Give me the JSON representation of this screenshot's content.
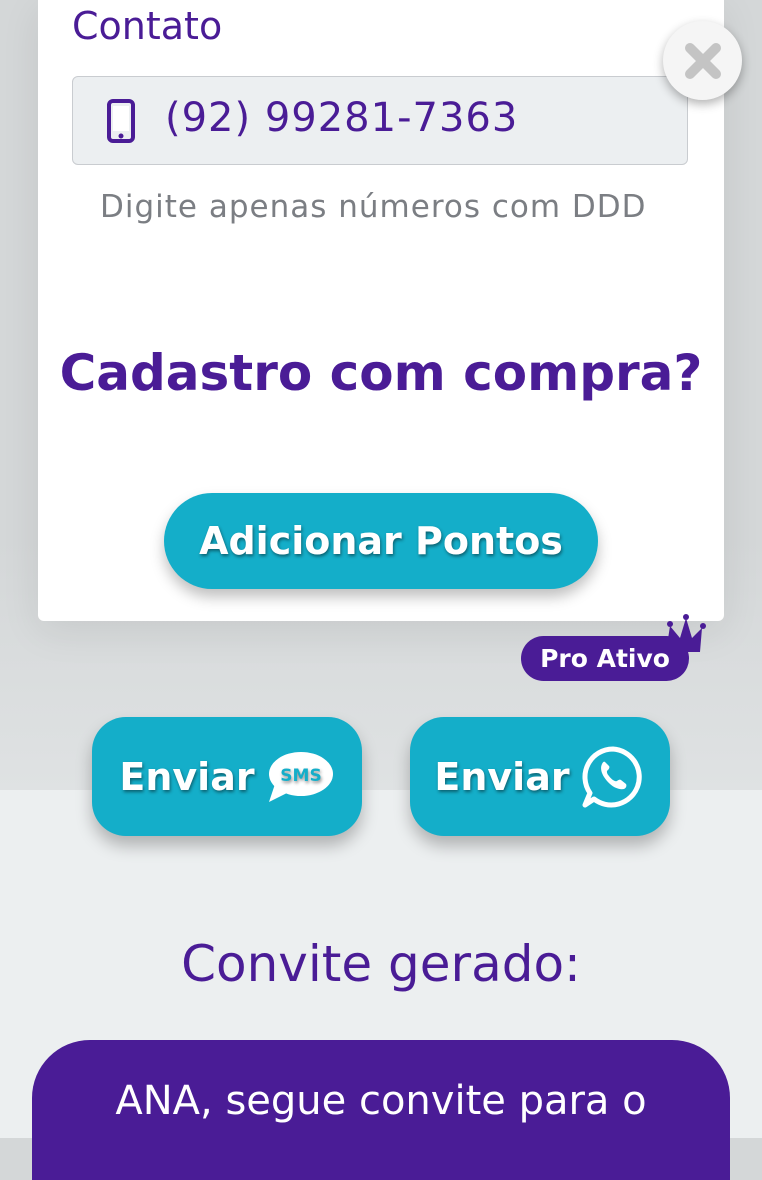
{
  "contact": {
    "label": "Contato",
    "phone_value": "(92) 99281-7363",
    "hint": "Digite apenas números com DDD"
  },
  "purchase": {
    "question": "Cadastro com compra?",
    "add_points_label": "Adicionar Pontos"
  },
  "pro_badge": "Pro Ativo",
  "send": {
    "sms_label": "Enviar",
    "sms_icon_text": "SMS",
    "whatsapp_label": "Enviar"
  },
  "invite": {
    "title": "Convite gerado:",
    "text": "ANA, segue convite para o"
  },
  "colors": {
    "purple": "#4a1c96",
    "teal": "#14aec9"
  },
  "icons": [
    "phone-icon",
    "close-icon",
    "crown-icon",
    "sms-bubble-icon",
    "whatsapp-icon"
  ]
}
